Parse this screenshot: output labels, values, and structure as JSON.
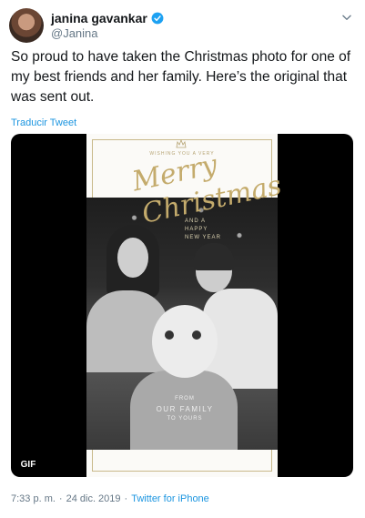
{
  "author": {
    "name": "janina gavankar",
    "handle": "@Janina",
    "verified": true
  },
  "tweet": {
    "text": "So proud to have taken the Christmas photo for one of my best friends and her family. Here’s the original that was sent out.",
    "translate_label": "Traducir Tweet"
  },
  "media": {
    "badge": "GIF",
    "card": {
      "wishing": "WISHING YOU A VERY",
      "merry": "Merry",
      "christmas": "Christmas",
      "and_happy_1": "AND A",
      "and_happy_2": "HAPPY",
      "and_happy_3": "NEW YEAR",
      "from_1": "FROM",
      "from_2": "OUR FAMILY",
      "from_3": "TO YOURS"
    }
  },
  "meta": {
    "time": "7:33 p. m.",
    "separator": "·",
    "date": "24 dic. 2019",
    "source": "Twitter for iPhone"
  },
  "colors": {
    "link": "#1b95e0",
    "gold": "#c4ab6c",
    "muted": "#657786"
  }
}
